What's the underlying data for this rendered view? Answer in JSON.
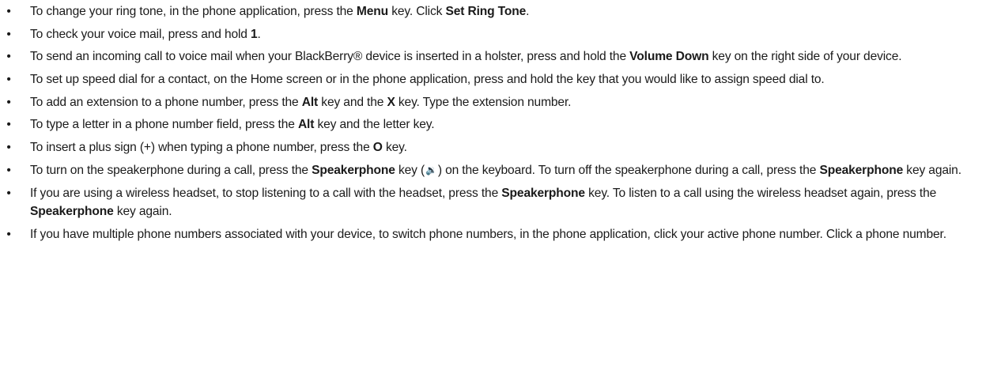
{
  "tips": [
    {
      "segments": [
        {
          "t": "To change your ring tone, in the phone application, press the "
        },
        {
          "t": "Menu",
          "b": true
        },
        {
          "t": " key. Click "
        },
        {
          "t": "Set Ring Tone",
          "b": true
        },
        {
          "t": "."
        }
      ]
    },
    {
      "segments": [
        {
          "t": "To check your voice mail, press and hold "
        },
        {
          "t": "1",
          "b": true
        },
        {
          "t": "."
        }
      ]
    },
    {
      "segments": [
        {
          "t": "To send an incoming call to voice mail when your BlackBerry® device is inserted in a holster, press and hold the "
        },
        {
          "t": "Volume Down",
          "b": true
        },
        {
          "t": " key on the right side of your device."
        }
      ]
    },
    {
      "segments": [
        {
          "t": "To set up speed dial for a contact, on the Home screen or in the phone application, press and hold the key that you would like to assign speed dial to."
        }
      ]
    },
    {
      "segments": [
        {
          "t": "To add an extension to a phone number, press the "
        },
        {
          "t": "Alt",
          "b": true
        },
        {
          "t": " key and the "
        },
        {
          "t": "X",
          "b": true
        },
        {
          "t": " key. Type the extension number."
        }
      ]
    },
    {
      "segments": [
        {
          "t": "To type a letter in a phone number field, press the "
        },
        {
          "t": "Alt",
          "b": true
        },
        {
          "t": " key and the letter key."
        }
      ]
    },
    {
      "segments": [
        {
          "t": "To insert a plus sign (+) when typing a phone number, press the "
        },
        {
          "t": "O",
          "b": true
        },
        {
          "t": " key."
        }
      ]
    },
    {
      "segments": [
        {
          "t": "To turn on the speakerphone during a call, press the "
        },
        {
          "t": "Speakerphone",
          "b": true
        },
        {
          "t": " key ("
        },
        {
          "icon": "speaker-icon",
          "glyph": "🔉"
        },
        {
          "t": ") on the keyboard. To turn off the speakerphone during a call, press the "
        },
        {
          "t": "Speakerphone",
          "b": true
        },
        {
          "t": " key again."
        }
      ]
    },
    {
      "segments": [
        {
          "t": "If you are using a wireless headset, to stop listening to a call with the headset, press the "
        },
        {
          "t": "Speakerphone",
          "b": true
        },
        {
          "t": " key. To listen to a call using the wireless headset again, press the "
        },
        {
          "t": "Speakerphone",
          "b": true
        },
        {
          "t": " key again."
        }
      ]
    },
    {
      "segments": [
        {
          "t": "If you have multiple phone numbers associated with your device, to switch phone numbers, in the phone application, click your active phone number. Click a phone number."
        }
      ]
    }
  ]
}
